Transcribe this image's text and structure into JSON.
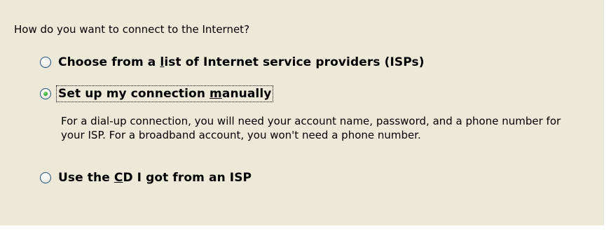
{
  "wizard": {
    "question": "How do you want to connect to the Internet?",
    "options": [
      {
        "label_before": "Choose from a ",
        "mnemonic": "l",
        "label_after": "ist of Internet service providers (ISPs)",
        "selected": false
      },
      {
        "label_before": "Set up my connection ",
        "mnemonic": "m",
        "label_after": "anually",
        "selected": true,
        "description": "For a dial-up connection, you will need your account name, password, and a phone number for your ISP. For a broadband account, you won't need a phone number."
      },
      {
        "label_before": "Use the ",
        "mnemonic": "C",
        "label_after": "D I got from an ISP",
        "selected": false
      }
    ]
  },
  "colors": {
    "dialog_background": "#ece9d8",
    "radio_border": "#1c5180",
    "radio_selected_dot": "#21a121"
  },
  "icons": {
    "radio_unselected": "radio-unselected-icon",
    "radio_selected": "radio-selected-icon"
  }
}
